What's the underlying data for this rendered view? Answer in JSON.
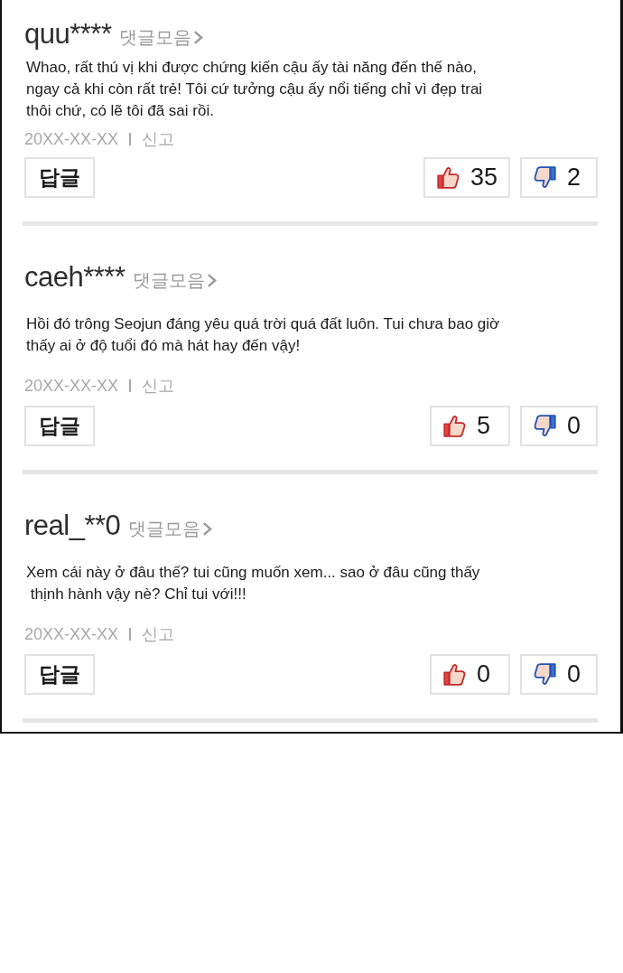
{
  "comments": [
    {
      "username": "quu****",
      "all_comments_link": "댓글모음",
      "text": "Whao, rất thú vị khi được chứng kiến cậu ấy tài năng đến thế nào,\nngay cả khi còn rất trẻ! Tôi cứ tưởng cậu ấy nổi tiếng chỉ vì đẹp trai\nthôi chứ, có lẽ tôi đã sai rồi.",
      "date": "20XX-XX-XX",
      "report": "신고",
      "reply": "답글",
      "likes": "35",
      "dislikes": "2"
    },
    {
      "username": "caeh****",
      "all_comments_link": "댓글모음",
      "text": "Hồi đó trông Seojun đáng yêu quá trời quá đất luôn. Tui chưa bao giờ\nthấy ai ở độ tuổi đó mà hát hay đến vậy!",
      "date": "20XX-XX-XX",
      "report": "신고",
      "reply": "답글",
      "likes": "5",
      "dislikes": "0"
    },
    {
      "username": "real_**0",
      "all_comments_link": "댓글모음",
      "text": "Xem cái này ở đâu thế? tui cũng muốn xem... sao ở đâu cũng thấy\n thịnh hành vậy nè? Chỉ tui với!!!",
      "date": "20XX-XX-XX",
      "report": "신고",
      "reply": "답글",
      "likes": "0",
      "dislikes": "0"
    }
  ]
}
